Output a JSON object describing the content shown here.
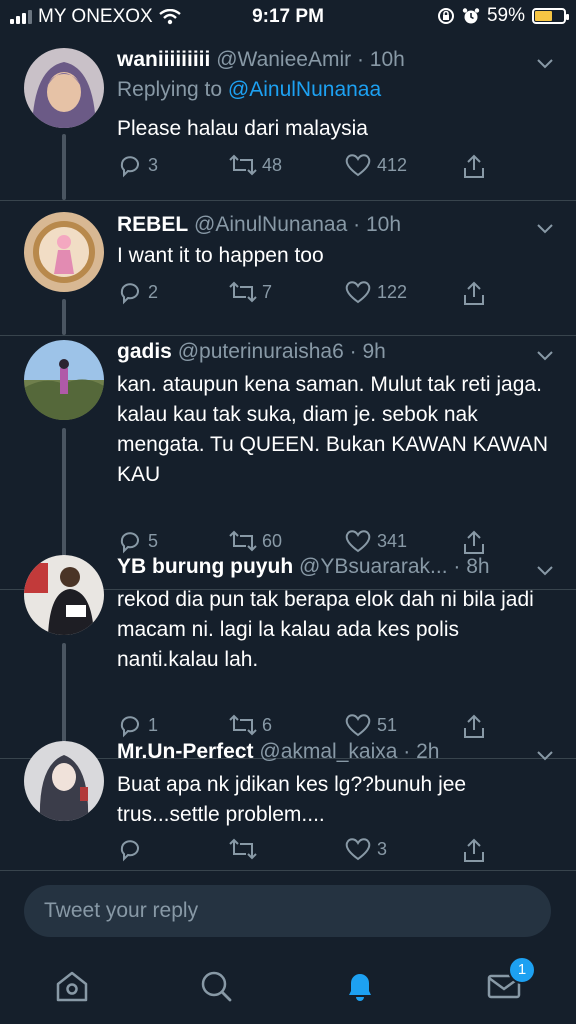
{
  "status_bar": {
    "carrier": "MY ONEXOX",
    "time": "9:17 PM",
    "battery_percent": "59%",
    "battery_level": 0.59,
    "accent": "#f6c544"
  },
  "tweets": [
    {
      "name": "waniiiiiiiii",
      "handle": "@WanieeAmir",
      "time": "· 10h",
      "replying_label": "Replying to",
      "replying_to": "@AinulNunanaa",
      "text": "Please halau dari malaysia",
      "replies": "3",
      "retweets": "48",
      "likes": "412"
    },
    {
      "name": "REBEL",
      "handle": "@AinulNunanaa",
      "time": "· 10h",
      "text": "I want it to happen too",
      "replies": "2",
      "retweets": "7",
      "likes": "122"
    },
    {
      "name": "gadis",
      "handle": "@puterinuraisha6",
      "time": "· 9h",
      "text": "kan. ataupun kena saman. Mulut tak reti jaga. kalau kau tak suka, diam je. sebok nak mengata. Tu QUEEN. Bukan KAWAN KAWAN KAU",
      "replies": "5",
      "retweets": "60",
      "likes": "341"
    },
    {
      "name": "YB burung puyuh",
      "handle": "@YBsuararak...",
      "time": "· 8h",
      "text": "rekod dia pun tak berapa elok dah ni bila jadi macam ni. lagi la kalau ada kes polis nanti.kalau lah.",
      "replies": "1",
      "retweets": "6",
      "likes": "51"
    },
    {
      "name": "Mr.Un-Perfect",
      "handle": "@akmal_kaixa",
      "time": "· 2h",
      "text": "Buat apa nk jdikan kes lg??bunuh jee trus...settle problem....",
      "replies": "",
      "retweets": "",
      "likes": "3"
    }
  ],
  "composer": {
    "placeholder": "Tweet your reply"
  },
  "tabbar": {
    "active": "notifications",
    "messages_badge": "1",
    "active_color": "#1da1f2"
  }
}
